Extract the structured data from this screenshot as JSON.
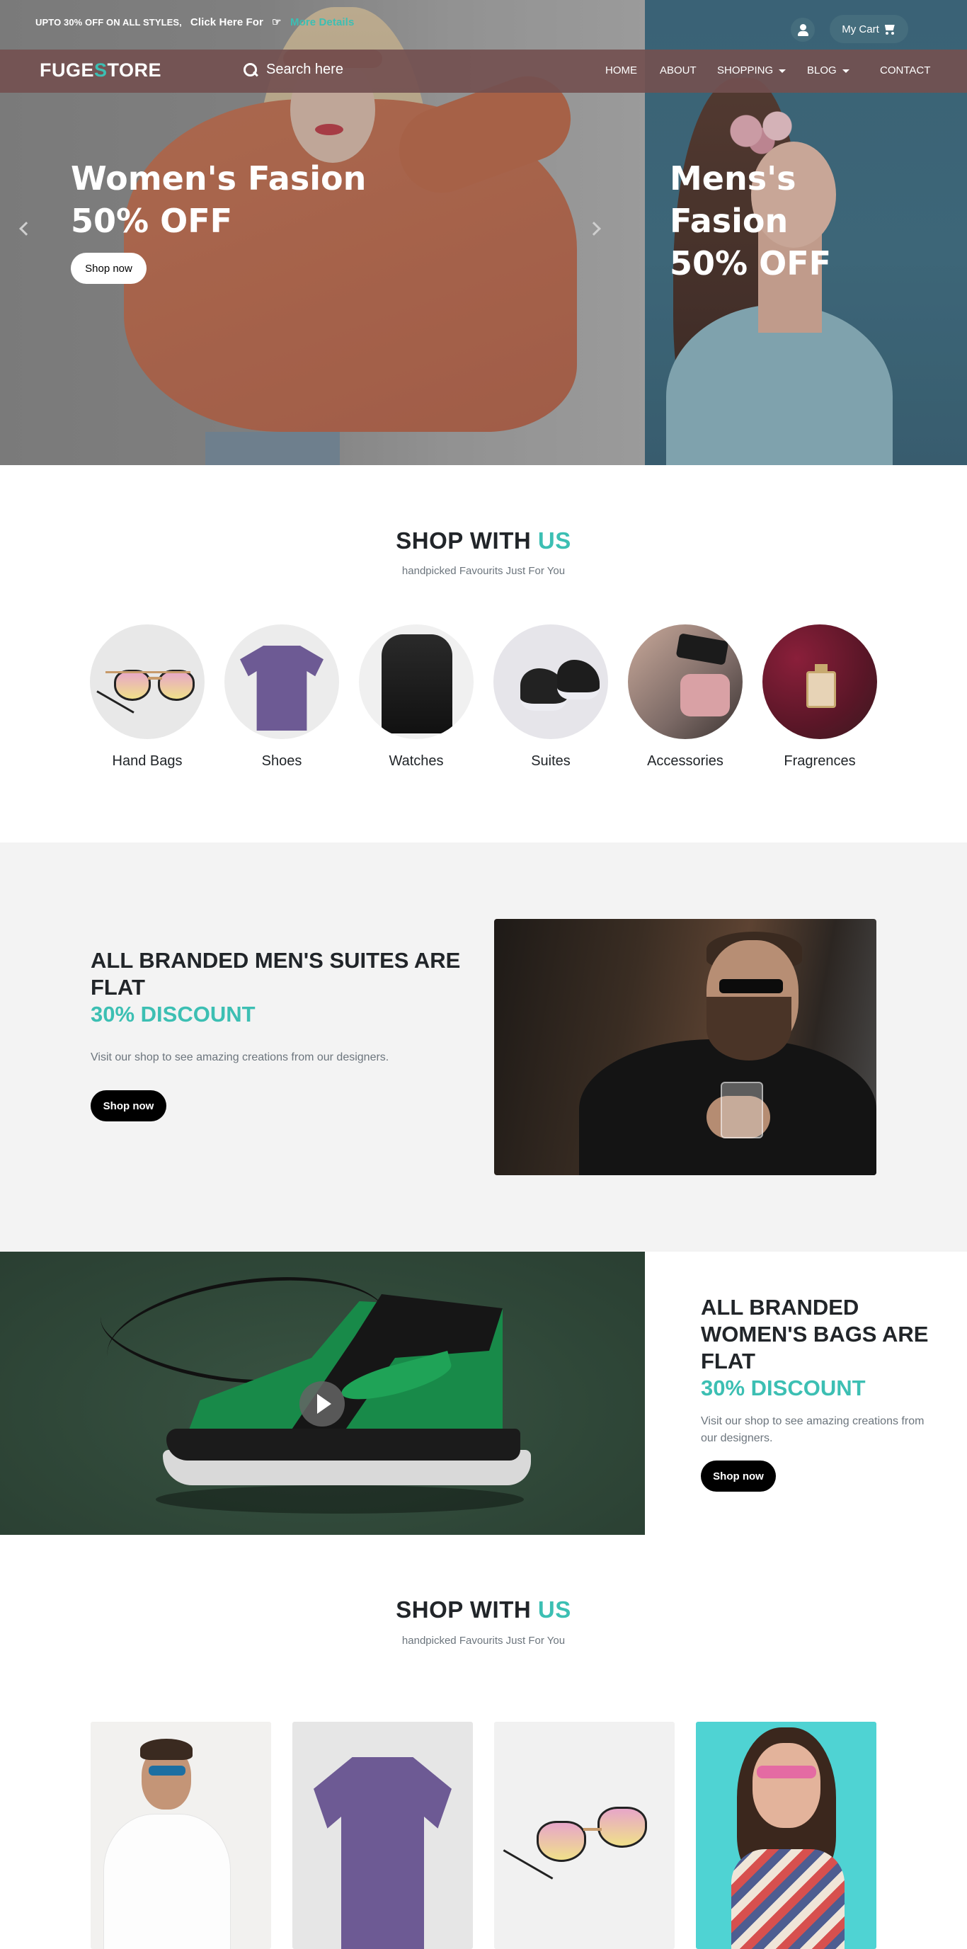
{
  "topbar": {
    "promo_text": "UPTO 30% OFF ON ALL STYLES,",
    "promo_cta": "Click Here For",
    "promo_link": "More Details",
    "cart_label": "My Cart"
  },
  "navbar": {
    "logo_part1": "FUGE",
    "logo_accent": "S",
    "logo_part2": "TORE",
    "search_placeholder": "Search here",
    "links": [
      "HOME",
      "ABOUT",
      "SHOPPING",
      "BLOG",
      "CONTACT"
    ]
  },
  "hero": {
    "left_line1": "Women's Fasion",
    "left_line2": "50% OFF",
    "left_button": "Shop now",
    "right_line1": "Mens's",
    "right_line2": "Fasion",
    "right_line3": "50% OFF"
  },
  "shop_section": {
    "title_main": "SHOP WITH",
    "title_accent": "US",
    "subtitle": "handpicked Favourits Just For You",
    "categories": [
      "Hand Bags",
      "Shoes",
      "Watches",
      "Suites",
      "Accessories",
      "Fragrences"
    ]
  },
  "promo_men": {
    "heading_line1": "ALL BRANDED MEN'S SUITES ARE",
    "heading_line2": "FLAT",
    "discount": "30% DISCOUNT",
    "text": "Visit our shop to see amazing creations from our designers.",
    "button": "Shop now"
  },
  "promo_women": {
    "heading_line1": "ALL BRANDED",
    "heading_line2": "WOMEN'S BAGS ARE",
    "heading_line3": "FLAT",
    "discount": "30% DISCOUNT",
    "text_line1": "Visit our shop to see amazing creations from",
    "text_line2": "our designers.",
    "button": "Shop now"
  },
  "shop_section_2": {
    "title_main": "SHOP WITH",
    "title_accent": "US",
    "subtitle": "handpicked Favourits Just For You"
  },
  "colors": {
    "accent": "#3cbfb3",
    "navbar": "#735050",
    "button_dark": "#000000",
    "section_gray": "#f3f3f3"
  },
  "icons": [
    "user-icon",
    "cart-icon",
    "search-icon",
    "hand-point-icon",
    "chevron-left-icon",
    "chevron-right-icon",
    "caret-down-icon",
    "play-icon"
  ]
}
